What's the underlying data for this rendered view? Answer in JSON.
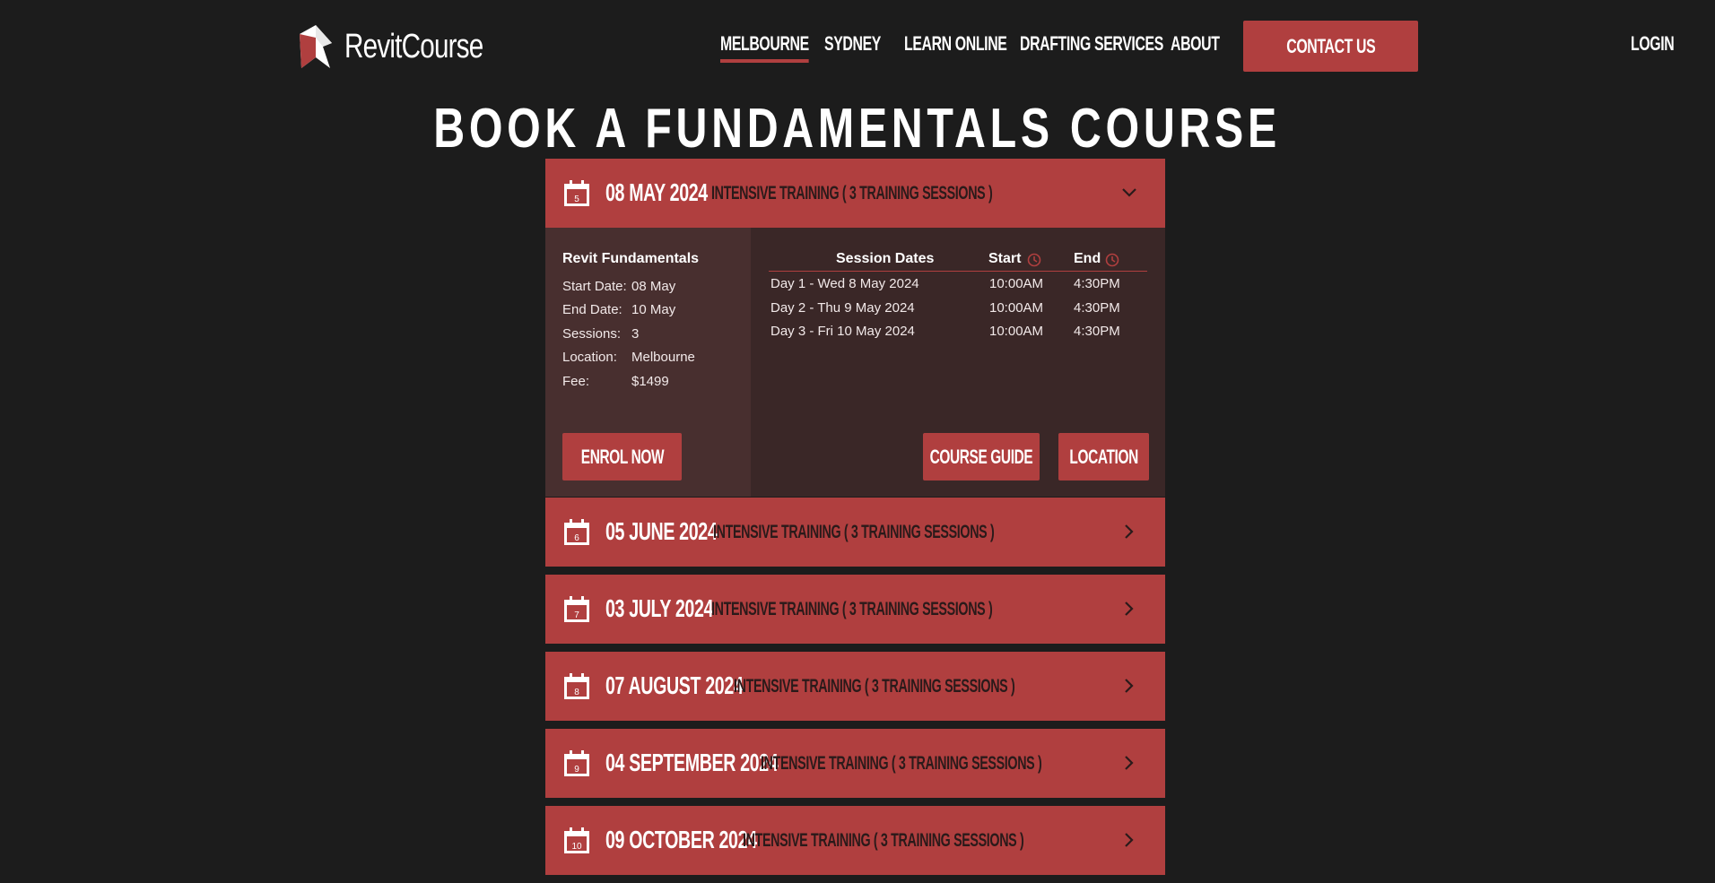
{
  "header": {
    "brand": "RevitCourse",
    "nav": [
      {
        "label": "MELBOURNE",
        "active": true
      },
      {
        "label": "SYDNEY",
        "active": false
      },
      {
        "label": "LEARN ONLINE",
        "active": false
      },
      {
        "label": "DRAFTING SERVICES",
        "active": false
      },
      {
        "label": "ABOUT",
        "active": false
      }
    ],
    "contact_label": "CONTACT US",
    "login_label": "LOGIN"
  },
  "page_title": "BOOK A FUNDAMENTALS COURSE",
  "colors": {
    "background": "#1c1c1c",
    "accent": "#b03f3f",
    "panel_left": "#482f2f",
    "panel_right": "#3a2727"
  },
  "courses": [
    {
      "date": "08 MAY 2024",
      "subtitle": "INTENSIVE TRAINING ( 3 TRAINING SESSIONS )",
      "calendar_day": "5",
      "expanded": true,
      "icon": "chevron-down-icon"
    },
    {
      "date": "05 JUNE 2024",
      "subtitle": "INTENSIVE TRAINING ( 3 TRAINING SESSIONS )",
      "calendar_day": "6",
      "expanded": false,
      "icon": "chevron-right-icon"
    },
    {
      "date": "03 JULY 2024",
      "subtitle": "INTENSIVE TRAINING ( 3 TRAINING SESSIONS )",
      "calendar_day": "7",
      "expanded": false,
      "icon": "chevron-right-icon"
    },
    {
      "date": "07 AUGUST 2024",
      "subtitle": "INTENSIVE TRAINING ( 3 TRAINING SESSIONS )",
      "calendar_day": "8",
      "expanded": false,
      "icon": "chevron-right-icon"
    },
    {
      "date": "04 SEPTEMBER 2024",
      "subtitle": "INTENSIVE TRAINING ( 3 TRAINING SESSIONS )",
      "calendar_day": "9",
      "expanded": false,
      "icon": "chevron-right-icon"
    },
    {
      "date": "09 OCTOBER 2024",
      "subtitle": "INTENSIVE TRAINING ( 3 TRAINING SESSIONS )",
      "calendar_day": "10",
      "expanded": false,
      "icon": "chevron-right-icon"
    }
  ],
  "expanded_course": {
    "name": "Revit Fundamentals",
    "details": [
      {
        "label": "Start Date:",
        "value": "08 May"
      },
      {
        "label": "End Date:",
        "value": "10 May"
      },
      {
        "label": "Sessions:",
        "value": "3"
      },
      {
        "label": "Location:",
        "value": "Melbourne"
      },
      {
        "label": "Fee:",
        "value": "$1499"
      }
    ],
    "table_headers": {
      "dates": "Session Dates",
      "start": "Start",
      "end": "End"
    },
    "sessions": [
      {
        "day": "Day 1 - Wed 8 May 2024",
        "start": "10:00AM",
        "end": "4:30PM"
      },
      {
        "day": "Day 2 - Thu 9 May 2024",
        "start": "10:00AM",
        "end": "4:30PM"
      },
      {
        "day": "Day 3 - Fri 10 May 2024",
        "start": "10:00AM",
        "end": "4:30PM"
      }
    ],
    "enrol_label": "ENROL NOW",
    "guide_label": "COURSE GUIDE",
    "location_label": "LOCATION"
  }
}
